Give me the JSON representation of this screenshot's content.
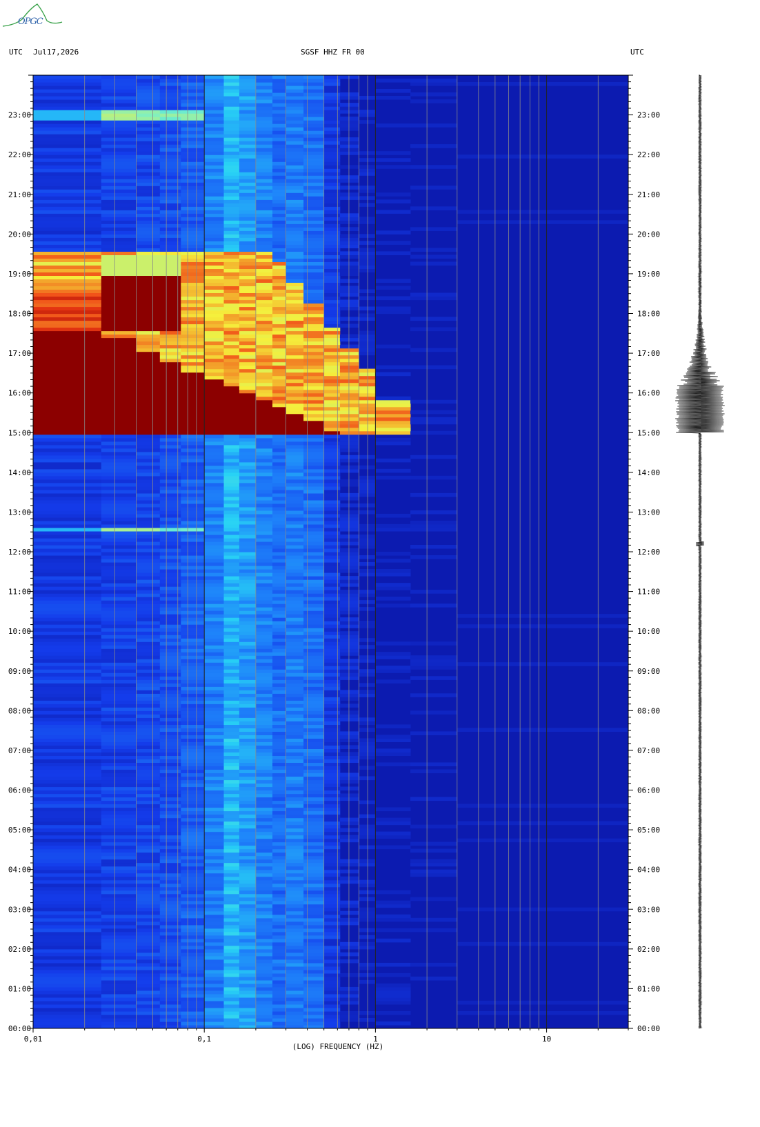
{
  "logo": {
    "text": "OPGC"
  },
  "header": {
    "left_tz": "UTC",
    "date": "Jul17,2026",
    "station": "SGSF HHZ FR 00",
    "right_tz": "UTC"
  },
  "chart_data": {
    "type": "heatmap",
    "title": "SGSF HHZ FR 00",
    "xlabel": "(LOG) FREQUENCY (HZ)",
    "ylabel": "",
    "x_scale": "log",
    "xlim": [
      0.01,
      30
    ],
    "ylim_hours": [
      0,
      24
    ],
    "x_tick_labels": [
      {
        "value": 0.01,
        "label": "0,01"
      },
      {
        "value": 0.1,
        "label": "0,1"
      },
      {
        "value": 1,
        "label": "1"
      },
      {
        "value": 10,
        "label": "10"
      }
    ],
    "y_tick_labels": [
      "00:00",
      "01:00",
      "02:00",
      "03:00",
      "04:00",
      "05:00",
      "06:00",
      "07:00",
      "08:00",
      "09:00",
      "10:00",
      "11:00",
      "12:00",
      "13:00",
      "14:00",
      "15:00",
      "16:00",
      "17:00",
      "18:00",
      "19:00",
      "20:00",
      "21:00",
      "22:00",
      "23:00"
    ],
    "colors": {
      "background": "#0c1bb0",
      "low": "#1a3ff0",
      "mid": "#28c8f0",
      "high_yellow": "#f8f040",
      "high_red": "#e82010",
      "saturated": "#8a0000"
    },
    "events": [
      {
        "start_hour": 15.0,
        "end_hour": 17.6,
        "description_hint": "large earthquake energy"
      },
      {
        "start_hour": 12.5,
        "end_hour": 12.65
      },
      {
        "start_hour": 22.85,
        "end_hour": 23.15
      }
    ]
  }
}
